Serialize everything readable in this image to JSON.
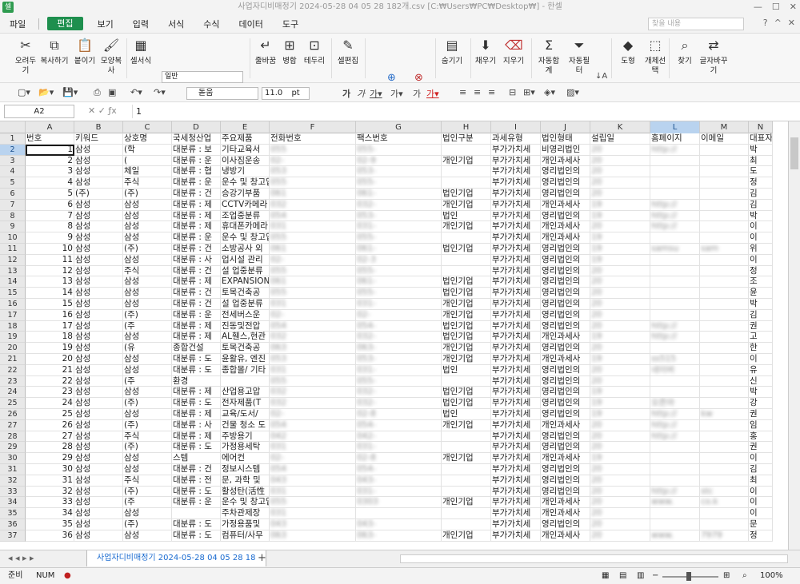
{
  "window": {
    "title": "사업자디비매정기 2024-05-28 04 05 28 182개.csv [C:₩Users₩PC₩Desktop₩] - 한셀"
  },
  "menu": {
    "items": [
      "파일",
      "편집",
      "보기",
      "입력",
      "서식",
      "수식",
      "데이터",
      "도구"
    ],
    "active_index": 1,
    "search_placeholder": "찾을 내용"
  },
  "ribbon": {
    "buttons": [
      "오려두기",
      "복사하기",
      "붙이기",
      "모양복사",
      "셀서식",
      "줄바꿈",
      "병합",
      "테두리",
      "셀편집",
      "숨기기",
      "채우기",
      "지우기",
      "자동합계",
      "자동필터",
      "도형",
      "개체선택",
      "찾기",
      "글자바꾸기"
    ],
    "number_format": "일반"
  },
  "toolbar": {
    "font": "돋움",
    "size": "11.0",
    "unit": "pt"
  },
  "formula": {
    "cell_ref": "A2",
    "value": "1"
  },
  "sheet": {
    "columns": [
      "A",
      "B",
      "C",
      "D",
      "E",
      "F",
      "G",
      "H",
      "I",
      "J",
      "K",
      "L",
      "M",
      "N"
    ],
    "selected_column": "L",
    "active_cell": "A2",
    "rows": [
      [
        "번호",
        "키워드",
        "상호명",
        "국세청산업",
        "주요제품",
        "전화번호",
        "팩스번호",
        "법인구분",
        "과세유형",
        "법인형태",
        "설립일",
        "홈페이지",
        "이메일",
        "대표자명"
      ],
      [
        "1",
        "삼성",
        "(학",
        "대분류 : 보",
        "기타교육서",
        "055",
        "055-",
        "",
        "부가가치세",
        "비영리법인",
        "20",
        "http://",
        "",
        "박"
      ],
      [
        "2",
        "삼성",
        "(",
        "대분류 : 운",
        "이사짐운송",
        "02-",
        "02-9",
        "개인기업",
        "부가가치세",
        "개인과세사",
        "20",
        "",
        "",
        "최"
      ],
      [
        "3",
        "삼성",
        "체일",
        "대분류 : 협",
        "냉방기",
        "053",
        "053-",
        "",
        "부가가치세",
        "영리법인의",
        "20",
        "",
        "",
        "도"
      ],
      [
        "4",
        "삼성",
        "주식",
        "대분류 : 운",
        "운수 및 창고업",
        "055",
        "055-",
        "",
        "부가가치세",
        "영리법인의",
        "20",
        "",
        "",
        "정"
      ],
      [
        "5",
        "(주)",
        "(주)",
        "대분류 : 건",
        "승강기부품",
        "061",
        "061-",
        "법인기업",
        "부가가치세",
        "영리법인의",
        "20",
        "",
        "",
        "김"
      ],
      [
        "6",
        "삼성",
        "삼성",
        "대분류 : 제",
        "CCTV카메라",
        "032",
        "032-",
        "개인기업",
        "부가가치세",
        "개인과세사",
        "19",
        "http://",
        "",
        "김"
      ],
      [
        "7",
        "삼성",
        "삼성",
        "대분류 : 제",
        "조업중분류",
        "054",
        "053-",
        "법인",
        "부가가치세",
        "영리법인의",
        "19",
        "http://",
        "",
        "박"
      ],
      [
        "8",
        "삼성",
        "삼성",
        "대분류 : 제",
        "휴대폰카메라",
        "031",
        "031-",
        "개인기업",
        "부가가치세",
        "개인과세사",
        "20",
        "http://",
        "",
        "이"
      ],
      [
        "9",
        "삼성",
        "삼성",
        "대분류 : 운",
        "운수 및 창고업",
        "055",
        "055-",
        "",
        "부가가치세",
        "개인과세사",
        "19",
        "",
        "",
        "이"
      ],
      [
        "10",
        "삼성",
        "(주)",
        "대분류 : 건",
        "소방공사 외",
        "061",
        "061-",
        "법인기업",
        "부가가치세",
        "영리법인의",
        "19",
        "samsu",
        "sam",
        "위"
      ],
      [
        "11",
        "삼성",
        "삼성",
        "대분류 : 사",
        "업시설 관리",
        "02-",
        "02-3",
        "",
        "부가가치세",
        "영리법인의",
        "19",
        "",
        "",
        "이"
      ],
      [
        "12",
        "삼성",
        "주식",
        "대분류 : 건",
        "설 업중분류",
        "055",
        "055-",
        "",
        "부가가치세",
        "영리법인의",
        "20",
        "",
        "",
        "정"
      ],
      [
        "13",
        "삼성",
        "삼성",
        "대분류 : 제",
        "EXPANSION",
        "061",
        "061-",
        "법인기업",
        "부가가치세",
        "영리법인의",
        "20",
        "",
        "",
        "조"
      ],
      [
        "14",
        "삼성",
        "삼성",
        "대분류 : 건",
        "토목건축공",
        "055",
        "055-",
        "법인기업",
        "부가가치세",
        "영리법인의",
        "20",
        "",
        "",
        "윤"
      ],
      [
        "15",
        "삼성",
        "삼성",
        "대분류 : 건",
        "설 업중분류",
        "031",
        "031-",
        "개인기업",
        "부가가치세",
        "영리법인의",
        "20",
        "",
        "",
        "박"
      ],
      [
        "16",
        "삼성",
        "(주)",
        "대분류 : 운",
        "전세버스운",
        "02-",
        "02-",
        "개인기업",
        "부가가치세",
        "영리법인의",
        "20",
        "",
        "",
        "김"
      ],
      [
        "17",
        "삼성",
        "(주",
        "대분류 : 제",
        "진동및전압",
        "054",
        "054-",
        "법인기업",
        "부가가치세",
        "영리법인의",
        "20",
        "http://",
        "",
        "권"
      ],
      [
        "18",
        "삼성",
        "삼성",
        "대분류 : 제",
        "AL휀스,현관",
        "032",
        "032-",
        "법인기업",
        "부가가치세",
        "개인과세사",
        "19",
        "http://",
        "",
        "고"
      ],
      [
        "19",
        "삼성",
        "(유",
        "종합건설",
        "토목건축공",
        "063",
        "063-",
        "개인기업",
        "부가가치세",
        "영리법인의",
        "20",
        "",
        "",
        "한"
      ],
      [
        "20",
        "삼성",
        "삼성",
        "대분류 : 도",
        "윤활유, 엔진",
        "053",
        "053-",
        "개인기업",
        "부가가치세",
        "개인과세사",
        "19",
        "ss515",
        "",
        "이"
      ],
      [
        "21",
        "삼성",
        "삼성",
        "대분류 : 도",
        "종합몰/ 기타",
        "031",
        "031-",
        "법인",
        "부가가치세",
        "영리법인의",
        "20",
        "네이버",
        "",
        "유"
      ],
      [
        "22",
        "삼성",
        "(주",
        "환경",
        "",
        "055",
        "055-",
        "",
        "부가가치세",
        "영리법인의",
        "20",
        "",
        "",
        "신"
      ],
      [
        "23",
        "삼성",
        "삼성",
        "대분류 : 제",
        "산업용고압",
        "032",
        "032-",
        "법인기업",
        "부가가치세",
        "영리법인의",
        "19",
        "",
        "",
        "박"
      ],
      [
        "24",
        "삼성",
        "(주)",
        "대분류 : 도",
        "전자제품(T",
        "032",
        "032-",
        "법인기업",
        "부가가치세",
        "영리법인의",
        "19",
        "오픈마",
        "",
        "강"
      ],
      [
        "25",
        "삼성",
        "삼성",
        "대분류 : 제",
        "교육/도서/",
        "02-",
        "02-8",
        "법인",
        "부가가치세",
        "영리법인의",
        "19",
        "http://",
        "kw",
        "권"
      ],
      [
        "26",
        "삼성",
        "(주)",
        "대분류 : 사",
        "건물 청소 도",
        "054",
        "054-",
        "개인기업",
        "부가가치세",
        "개인과세사",
        "20",
        "http://",
        "",
        "임"
      ],
      [
        "27",
        "삼성",
        "주식",
        "대분류 : 제",
        "주방용기",
        "042",
        "042-",
        "",
        "부가가치세",
        "영리법인의",
        "20",
        "http://",
        "",
        "홍"
      ],
      [
        "28",
        "삼성",
        "(주)",
        "대분류 : 도",
        "가정용세탁",
        "031",
        "031-",
        "",
        "부가가치세",
        "영리법인의",
        "20",
        "",
        "",
        "권"
      ],
      [
        "29",
        "삼성",
        "삼성",
        "스템",
        "에어컨",
        "02-",
        "02-8",
        "개인기업",
        "부가가치세",
        "개인과세사",
        "19",
        "",
        "",
        "이"
      ],
      [
        "30",
        "삼성",
        "삼성",
        "대분류 : 건",
        "정보시스템",
        "054",
        "054-",
        "",
        "부가가치세",
        "영리법인의",
        "20",
        "",
        "",
        "김"
      ],
      [
        "31",
        "삼성",
        "주식",
        "대분류 : 전",
        "문, 과학 및",
        "043",
        "043-",
        "",
        "부가가치세",
        "영리법인의",
        "20",
        "",
        "",
        "최"
      ],
      [
        "32",
        "삼성",
        "(주)",
        "대분류 : 도",
        "활성탄(活性",
        "031",
        "031-",
        "",
        "부가가치세",
        "영리법인의",
        "20",
        "http://",
        "stc",
        "이"
      ],
      [
        "33",
        "삼성",
        "(주",
        "대분류 : 운",
        "운수 및 창고업",
        "055",
        "0303",
        "개인기업",
        "부가가치세",
        "개인과세사",
        "20",
        "www.",
        "co.k",
        "이"
      ],
      [
        "34",
        "삼성",
        "삼성",
        "",
        "주차관제장",
        "031",
        "",
        "",
        "부가가치세",
        "개인과세사",
        "20",
        "",
        "",
        "이"
      ],
      [
        "35",
        "삼성",
        "(주)",
        "대분류 : 도",
        "가정용품및",
        "043",
        "043-",
        "",
        "부가가치세",
        "영리법인의",
        "20",
        "",
        "",
        "문"
      ],
      [
        "36",
        "삼성",
        "삼성",
        "대분류 : 도",
        "컴퓨터/사무",
        "063",
        "063-",
        "개인기업",
        "부가가치세",
        "개인과세사",
        "20",
        "www.",
        "7979",
        "정"
      ]
    ]
  },
  "sheet_tab": "사업자디비매정기 2024-05-28 04 05 28 18",
  "status": {
    "mode": "준비",
    "num": "NUM",
    "zoom": "100%"
  }
}
